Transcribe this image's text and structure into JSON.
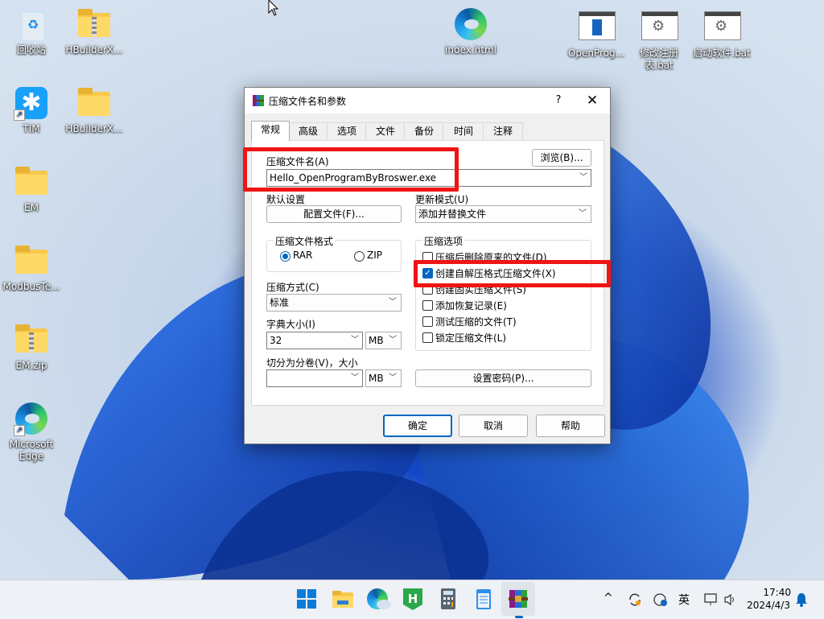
{
  "desktop": {
    "icons": [
      {
        "label": "回收站"
      },
      {
        "label": "HBuilderX..."
      },
      {
        "label": "TIM"
      },
      {
        "label": "HBuilderX..."
      },
      {
        "label": "EM"
      },
      {
        "label": "ModbusTe..."
      },
      {
        "label": "EM.zip"
      },
      {
        "label": "Microsoft Edge"
      },
      {
        "label": "index.html"
      },
      {
        "label": "OpenProg..."
      },
      {
        "label": "修改注册表.bat"
      },
      {
        "label": "启动软件.bat"
      }
    ]
  },
  "dialog": {
    "title": "压缩文件名和参数",
    "help_glyph": "?",
    "close_glyph": "✕",
    "tabs": [
      "常规",
      "高级",
      "选项",
      "文件",
      "备份",
      "时间",
      "注释"
    ],
    "archive_name_label": "压缩文件名(A)",
    "archive_name_value": "Hello_OpenProgramByBroswer.exe",
    "browse_button": "浏览(B)...",
    "default_settings_label": "默认设置",
    "profile_button": "配置文件(F)...",
    "update_mode_label": "更新模式(U)",
    "update_mode_value": "添加并替换文件",
    "format_group_title": "压缩文件格式",
    "format_rar": "RAR",
    "format_zip": "ZIP",
    "method_label": "压缩方式(C)",
    "method_value": "标准",
    "dict_label": "字典大小(I)",
    "dict_value": "32",
    "dict_unit": "MB",
    "split_label": "切分为分卷(V)，大小",
    "split_value": "",
    "split_unit": "MB",
    "options_group_title": "压缩选项",
    "options": [
      {
        "label": "压缩后删除原来的文件(D)",
        "checked": false
      },
      {
        "label": "创建自解压格式压缩文件(X)",
        "checked": true
      },
      {
        "label": "创建固实压缩文件(S)",
        "checked": false
      },
      {
        "label": "添加恢复记录(E)",
        "checked": false
      },
      {
        "label": "测试压缩的文件(T)",
        "checked": false
      },
      {
        "label": "锁定压缩文件(L)",
        "checked": false
      }
    ],
    "password_button": "设置密码(P)...",
    "ok_button": "确定",
    "cancel_button": "取消",
    "help_button": "帮助"
  },
  "taskbar": {
    "apps": [
      "start-icon",
      "file-explorer-icon",
      "edge-icon",
      "hbuilderx-icon",
      "calculator-icon",
      "notepad-icon",
      "winrar-icon"
    ],
    "chevron": "^",
    "ime": "英",
    "time": "17:40",
    "date": "2024/4/3"
  },
  "colors": {
    "accent": "#0067c0",
    "highlight": "#f01414"
  }
}
